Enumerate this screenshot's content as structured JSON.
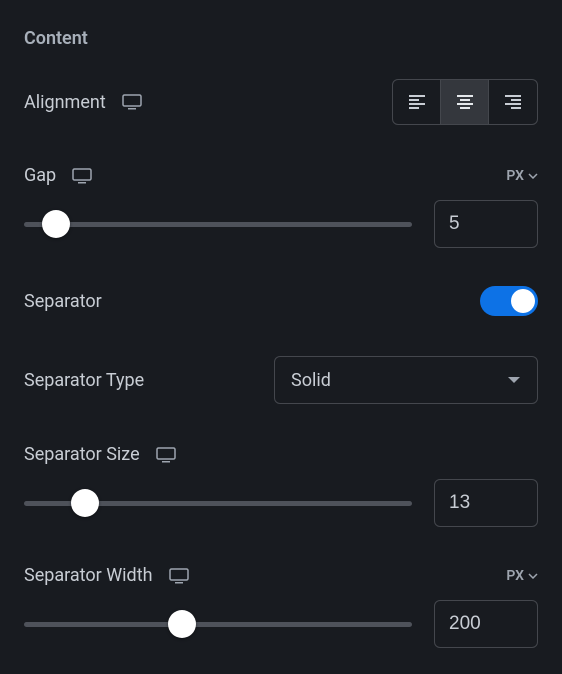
{
  "section_title": "Content",
  "alignment": {
    "label": "Alignment",
    "options": [
      "left",
      "center",
      "right"
    ],
    "selected": "center"
  },
  "gap": {
    "label": "Gap",
    "unit": "PX",
    "value": "5"
  },
  "separator": {
    "label": "Separator",
    "enabled": true
  },
  "separator_type": {
    "label": "Separator Type",
    "selected": "Solid"
  },
  "separator_size": {
    "label": "Separator Size",
    "value": "13"
  },
  "separator_width": {
    "label": "Separator Width",
    "unit": "PX",
    "value": "200"
  }
}
